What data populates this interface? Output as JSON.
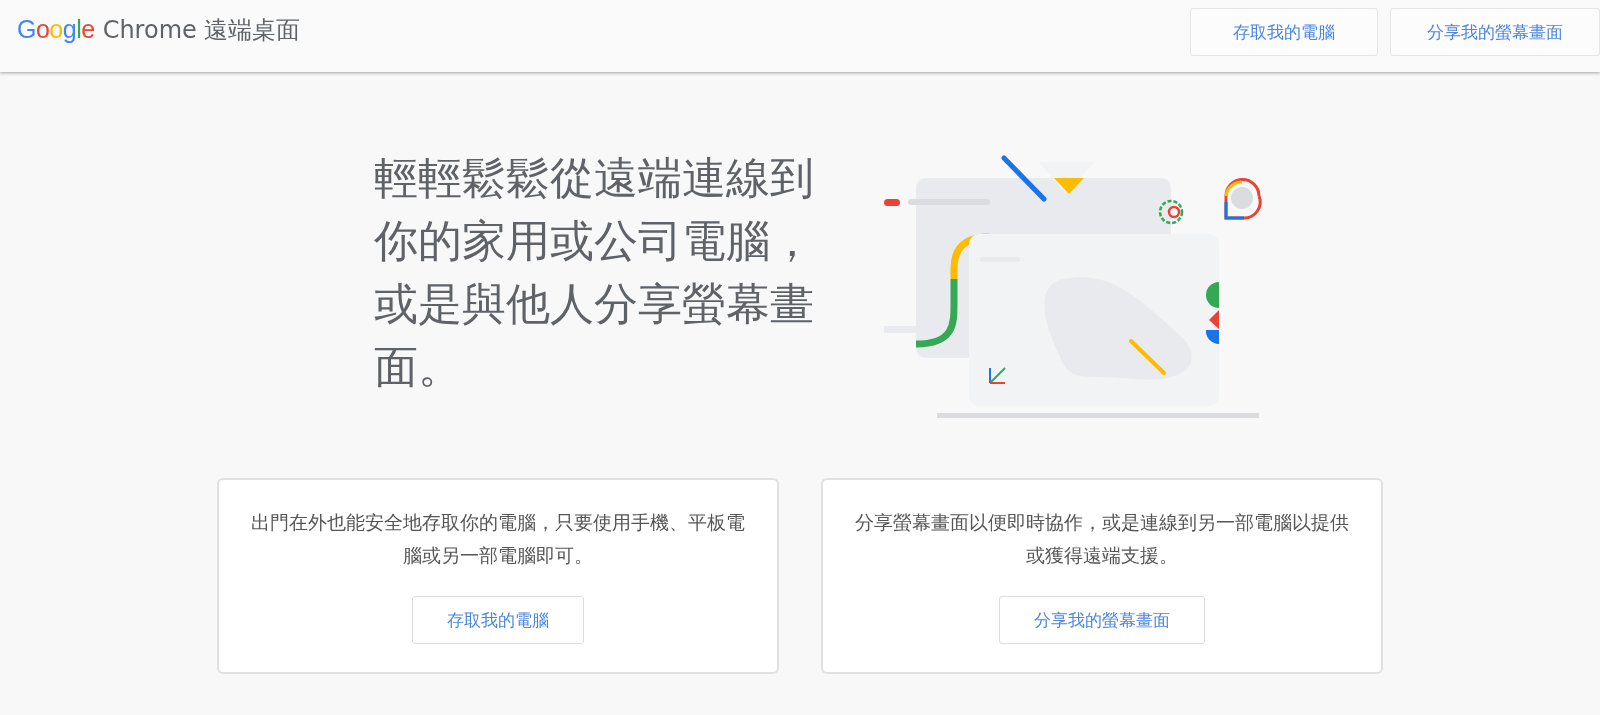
{
  "header": {
    "logo": "Google",
    "product": "Chrome 遠端桌面",
    "buttons": [
      "存取我的電腦",
      "分享我的螢幕畫面"
    ]
  },
  "hero": {
    "headline": "輕輕鬆鬆從遠端連線到你的家用或公司電腦，或是與他人分享螢幕畫面。"
  },
  "cards": [
    {
      "text": "出門在外也能安全地存取你的電腦，只要使用手機、平板電腦或另一部電腦即可。",
      "button": "存取我的電腦"
    },
    {
      "text": "分享螢幕畫面以便即時協作，或是連線到另一部電腦以提供或獲得遠端支援。",
      "button": "分享我的螢幕畫面"
    }
  ]
}
